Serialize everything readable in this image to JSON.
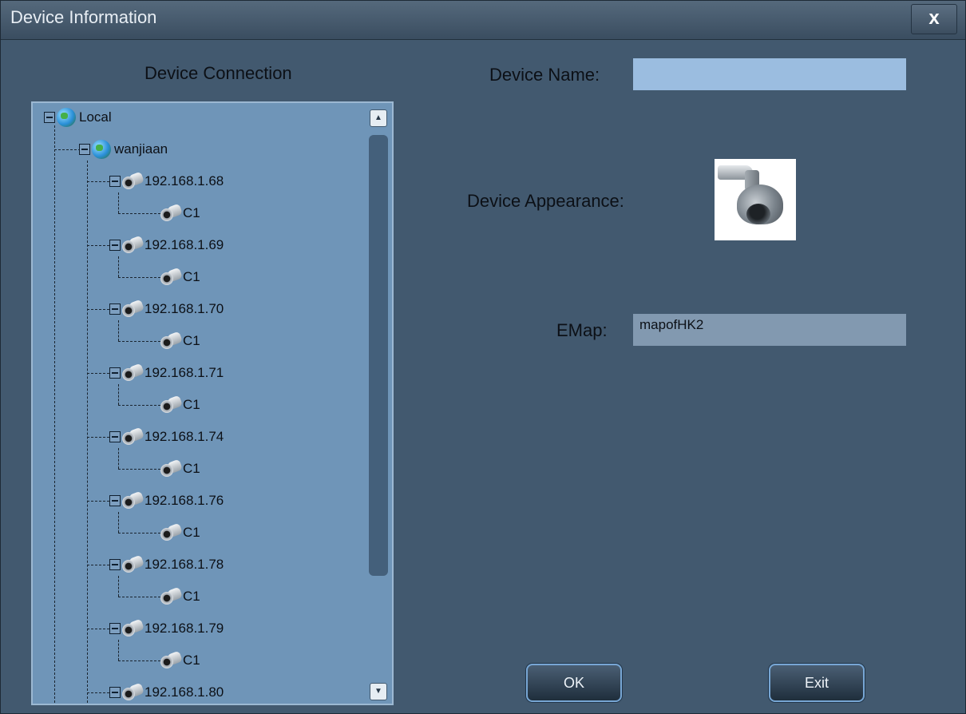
{
  "window": {
    "title": "Device Information",
    "close_label": "x"
  },
  "tree": {
    "title": "Device Connection",
    "root": "Local",
    "group": "wanjiaan",
    "devices": [
      {
        "ip": "192.168.1.68",
        "channel": "C1"
      },
      {
        "ip": "192.168.1.69",
        "channel": "C1"
      },
      {
        "ip": "192.168.1.70",
        "channel": "C1"
      },
      {
        "ip": "192.168.1.71",
        "channel": "C1"
      },
      {
        "ip": "192.168.1.74",
        "channel": "C1"
      },
      {
        "ip": "192.168.1.76",
        "channel": "C1"
      },
      {
        "ip": "192.168.1.78",
        "channel": "C1"
      },
      {
        "ip": "192.168.1.79",
        "channel": "C1"
      },
      {
        "ip": "192.168.1.80"
      }
    ],
    "icons": {
      "root": "globe-icon",
      "group": "globe-icon",
      "device": "camera-icon",
      "channel": "camera-icon",
      "scroll_up": "arrow-up-icon",
      "scroll_down": "arrow-down-icon"
    }
  },
  "form": {
    "device_name_label": "Device Name:",
    "device_name_value": "",
    "appearance_label": "Device Appearance:",
    "appearance_icon": "dome-camera-icon",
    "emap_label": "EMap:",
    "emap_value": "mapofHK2"
  },
  "buttons": {
    "ok": "OK",
    "exit": "Exit"
  },
  "colors": {
    "background": "#42596f",
    "tree_background": "#6f95b8",
    "input": "#9bbde0",
    "emap_field": "#8299b0",
    "button_border": "#77a6d4"
  }
}
